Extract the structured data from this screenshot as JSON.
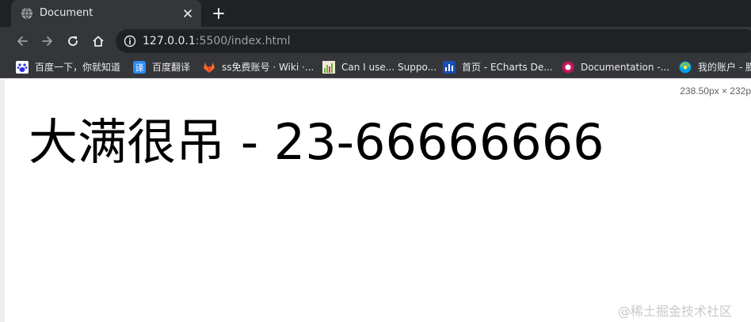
{
  "tab": {
    "title": "Document",
    "favicon": "globe-icon",
    "close_icon": "close-icon"
  },
  "new_tab_icon": "plus-icon",
  "toolbar": {
    "back_icon": "arrow-left-icon",
    "forward_icon": "arrow-right-icon",
    "reload_icon": "reload-icon",
    "home_icon": "home-icon",
    "url_host": "127.0.0.1",
    "url_rest": ":5500/index.html",
    "info_icon": "info-icon"
  },
  "bookmarks": [
    {
      "label": "百度一下，你就知道",
      "icon": "baidu-paw-icon",
      "color": "#2932e1"
    },
    {
      "label": "百度翻译",
      "icon": "translate-icon",
      "color": "#2c8cf4"
    },
    {
      "label": "ss免费账号 · Wiki ·...",
      "icon": "gitlab-icon",
      "color": "#fc6d26"
    },
    {
      "label": "Can I use... Suppo...",
      "icon": "caniuse-icon",
      "color": "#6aaf3f"
    },
    {
      "label": "首页 - ECharts De...",
      "icon": "echarts-icon",
      "color": "#1a4fb5"
    },
    {
      "label": "Documentation -...",
      "icon": "documentation-icon",
      "color": "#c2185b"
    },
    {
      "label": "我的账户 - 膨",
      "icon": "account-icon",
      "color": "#00a0e9"
    }
  ],
  "content": {
    "dimensions": "238.50px × 232p",
    "headline": "大满很吊 - 23-66666666",
    "watermark": "@稀土掘金技术社区"
  },
  "colors": {
    "tab_strip": "#202124",
    "toolbar": "#35363a",
    "omnibox": "#202124",
    "text_light": "#e8eaed",
    "text_muted": "#9aa0a6"
  }
}
